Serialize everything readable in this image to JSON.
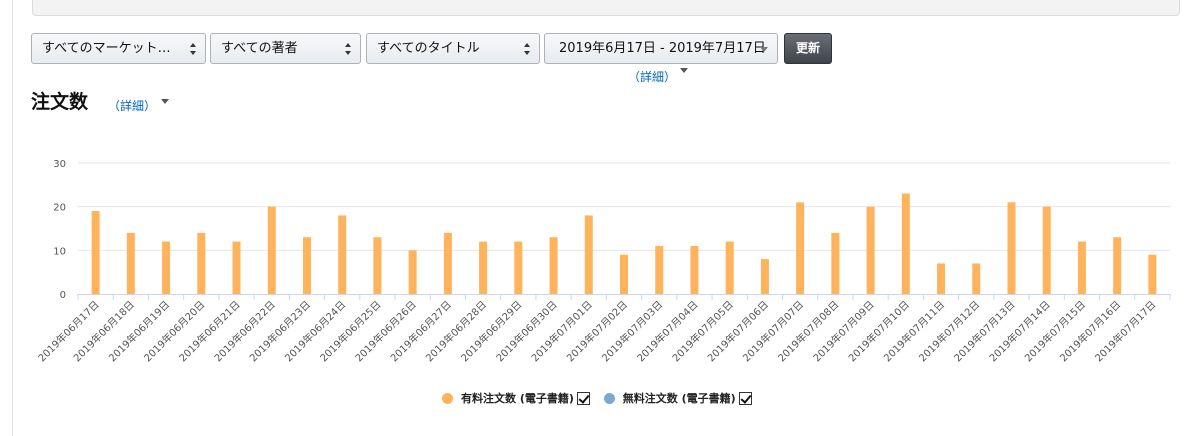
{
  "filters": {
    "market": "すべてのマーケット…",
    "author": "すべての著者",
    "title": "すべてのタイトル",
    "date_range": "2019年6月17日 - 2019年7月17日",
    "update_label": "更新",
    "date_detail_label": "（詳細）"
  },
  "section": {
    "title": "注文数",
    "detail_label": "（詳細）"
  },
  "colors": {
    "paid": "#ffb35c",
    "free": "#7fa7d6",
    "grid": "#e6e6e6",
    "axis": "#ccd6eb"
  },
  "chart_data": {
    "type": "bar",
    "title": "",
    "xlabel": "",
    "ylabel": "",
    "ylim": [
      0,
      30
    ],
    "yticks": [
      0,
      10,
      20,
      30
    ],
    "grid": true,
    "legend_position": "bottom-center",
    "categories": [
      "2019年06月17日",
      "2019年06月18日",
      "2019年06月19日",
      "2019年06月20日",
      "2019年06月21日",
      "2019年06月22日",
      "2019年06月23日",
      "2019年06月24日",
      "2019年06月25日",
      "2019年06月26日",
      "2019年06月27日",
      "2019年06月28日",
      "2019年06月29日",
      "2019年06月30日",
      "2019年07月01日",
      "2019年07月02日",
      "2019年07月03日",
      "2019年07月04日",
      "2019年07月05日",
      "2019年07月06日",
      "2019年07月07日",
      "2019年07月08日",
      "2019年07月09日",
      "2019年07月10日",
      "2019年07月11日",
      "2019年07月12日",
      "2019年07月13日",
      "2019年07月14日",
      "2019年07月15日",
      "2019年07月16日",
      "2019年07月17日"
    ],
    "series": [
      {
        "name": "有料注文数 (電子書籍)",
        "values": [
          19,
          14,
          12,
          14,
          12,
          20,
          13,
          18,
          13,
          10,
          14,
          12,
          12,
          13,
          18,
          9,
          11,
          11,
          12,
          8,
          21,
          14,
          20,
          23,
          7,
          7,
          21,
          20,
          12,
          13,
          9
        ]
      },
      {
        "name": "無料注文数 (電子書籍)",
        "values": [
          0,
          0,
          0,
          0,
          0,
          0,
          0,
          0,
          0,
          0,
          0,
          0,
          0,
          0,
          0,
          0,
          0,
          0,
          0,
          0,
          0,
          0,
          0,
          0,
          0,
          0,
          0,
          0,
          0,
          0,
          0
        ]
      }
    ]
  }
}
